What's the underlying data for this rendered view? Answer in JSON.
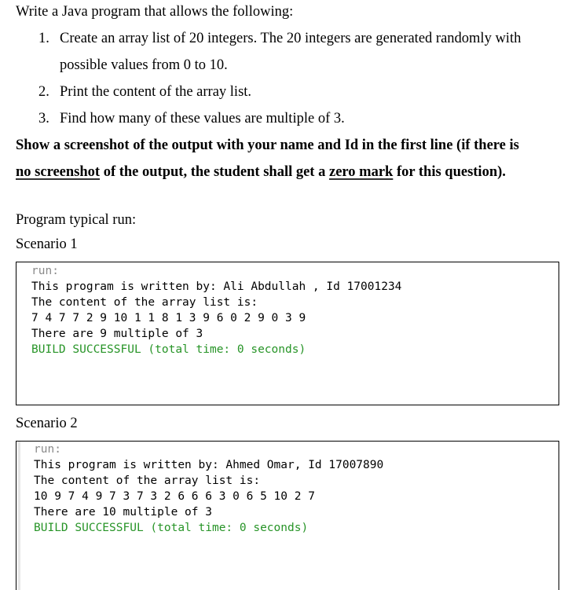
{
  "question": {
    "intro": "Write a Java program that allows the following:",
    "items": [
      {
        "number": "1.",
        "text_line1": "Create an array list of 20 integers. The 20 integers are generated randomly with",
        "text_line2": "possible values from 0 to 10."
      },
      {
        "number": "2.",
        "text": "Print the content of the array list."
      },
      {
        "number": "3.",
        "text": "Find how many of these values are multiple of 3."
      }
    ],
    "note": {
      "line1": "Show a screenshot of the output with your name and Id in the first line (if there is",
      "underline1": "no screenshot",
      "mid": " of the output, the student shall get a ",
      "underline2": "zero mark",
      "end": " for this question)."
    }
  },
  "typical_run_label": "Program typical run:",
  "scenarios": [
    {
      "label": "Scenario 1",
      "output": {
        "run": "run:",
        "author_line": "This program is written by: Ali Abdullah , Id 17001234",
        "content_label": "The content of the array list is:",
        "values": "7 4 7 7 2 9 10 1 1 8 1 3 9 6 0 2 9 0 3 9",
        "result": "There are 9 multiple of 3",
        "build": "BUILD SUCCESSFUL (total time: 0 seconds)"
      }
    },
    {
      "label": "Scenario 2",
      "output": {
        "run": "run:",
        "author_line": "This program is written by: Ahmed Omar, Id 17007890",
        "content_label": "The content of the array list is:",
        "values": "10 9 7 4 9 7 3 7 3 2 6 6 6 3 0 6 5 10 2 7",
        "result": "There are 10 multiple of 3",
        "build": "BUILD SUCCESSFUL (total time: 0 seconds)"
      }
    }
  ],
  "colors": {
    "build_success": "#279427",
    "run_label": "#8a8a8a"
  }
}
